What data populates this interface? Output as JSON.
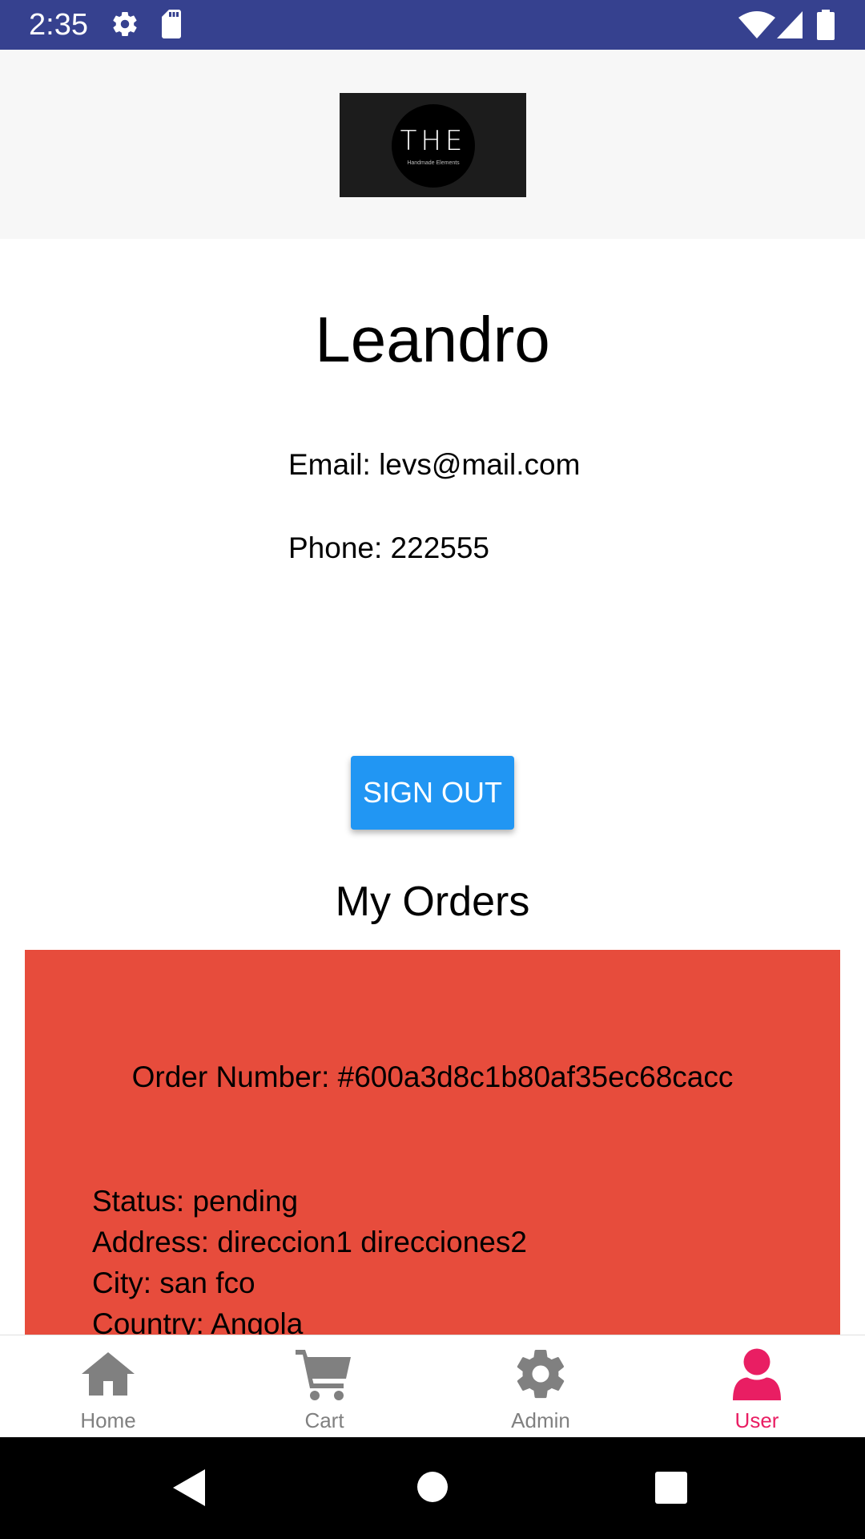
{
  "status_bar": {
    "time": "2:35"
  },
  "header": {
    "logo_text": "THE",
    "logo_subtext": "Handmade Elements"
  },
  "profile": {
    "name": "Leandro",
    "email_line": "Email: levs@mail.com",
    "phone_line": "Phone: 222555"
  },
  "actions": {
    "sign_out_label": "SIGN OUT"
  },
  "orders": {
    "title": "My Orders",
    "items": [
      {
        "order_number": "Order Number: #600a3d8c1b80af35ec68cacc",
        "status": "Status: pending",
        "address": "Address: direccion1 direcciones2",
        "city": "City: san fco",
        "country": "Country: Angola"
      }
    ]
  },
  "bottom_nav": {
    "items": [
      {
        "label": "Home",
        "icon": "home-icon"
      },
      {
        "label": "Cart",
        "icon": "cart-icon"
      },
      {
        "label": "Admin",
        "icon": "gear-icon"
      },
      {
        "label": "User",
        "icon": "user-icon",
        "active": true
      }
    ]
  },
  "colors": {
    "status_bar": "#36418f",
    "button": "#2196f3",
    "order_card": "#e74c3c",
    "active_tab": "#e91e63",
    "inactive_tab": "#808080"
  }
}
